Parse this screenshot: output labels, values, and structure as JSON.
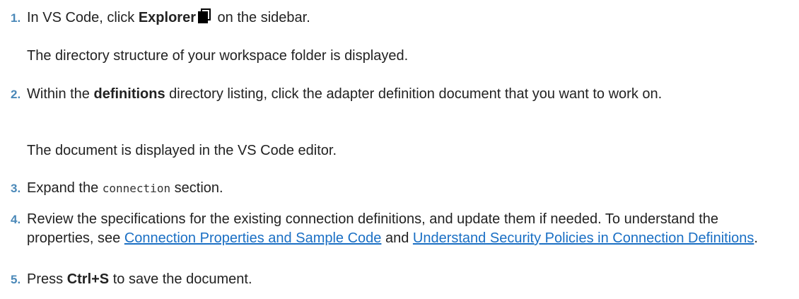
{
  "steps": [
    {
      "number": "1.",
      "text_before": "In VS Code, click ",
      "bold": "Explorer",
      "icon": "explorer-files-icon",
      "text_after": " on the sidebar.",
      "result": "The directory structure of your workspace folder is displayed."
    },
    {
      "number": "2.",
      "text_before": "Within the ",
      "bold": "definitions",
      "text_after": " directory listing, click the adapter definition document that you want to work on.",
      "result": "The document is displayed in the VS Code editor."
    },
    {
      "number": "3.",
      "text_before": "Expand the ",
      "code": "connection",
      "text_after": " section."
    },
    {
      "number": "4.",
      "text_before": "Review the specifications for the existing connection definitions, and update them if needed. To understand the properties, see ",
      "link1": "Connection Properties and Sample Code",
      "text_middle": " and ",
      "link2": "Understand Security Policies in Connection Definitions",
      "text_after": "."
    },
    {
      "number": "5.",
      "text_before": "Press ",
      "bold": "Ctrl+S",
      "text_after": " to save the document."
    }
  ],
  "colors": {
    "step_number": "#4a88b8",
    "link": "#1a6fc4",
    "text": "#222222"
  }
}
